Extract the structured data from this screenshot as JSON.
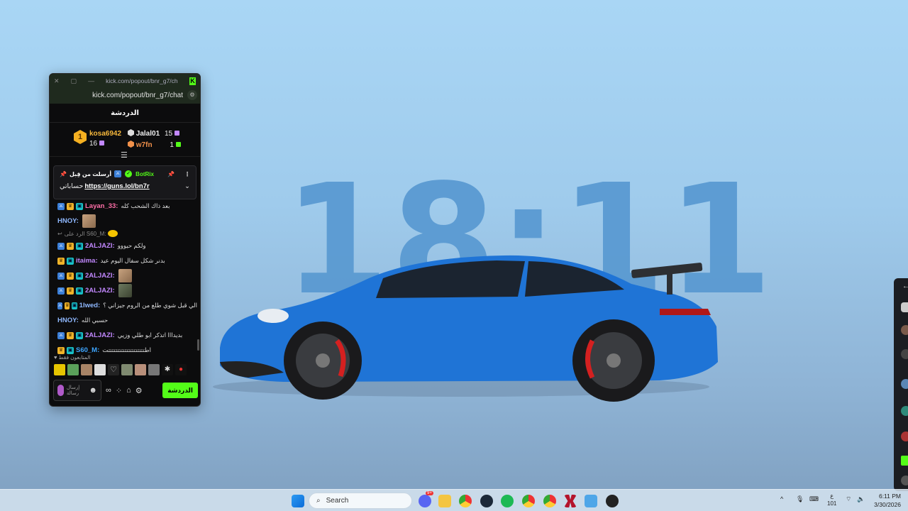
{
  "wallpaper": {
    "clock": "18:11"
  },
  "popout": {
    "window_title": "kick.com/popout/bnr_g7/ch...",
    "url": "kick.com/popout/bnr_g7/chat",
    "chat_heading": "الدردشة",
    "leaderboard": [
      {
        "rank": "1",
        "name": "kosa6942",
        "count": "16"
      },
      {
        "name": "Jalal01",
        "count": "15"
      },
      {
        "name": "w7fn",
        "count": "1"
      }
    ],
    "pinned": {
      "user": "BotRix",
      "sent_by_label": "أرسلت من قِبل",
      "message_prefix": "حساباتي",
      "link": "https://guns.lol/bn7r"
    },
    "messages": [
      {
        "user": "Layan_33:",
        "text": "بعد ذاك الشحب كله"
      },
      {
        "user": "HNOY:",
        "text": ""
      },
      {
        "reply": "الرد على S60_M:"
      },
      {
        "user": "2ALJAZI:",
        "text": "ولكم حيووو"
      },
      {
        "user": "itaima:",
        "text": "بدنر شكل سفال اليوم عيد"
      },
      {
        "user": "2ALJAZI:",
        "text": ""
      },
      {
        "user": "2ALJAZI:",
        "text": ""
      },
      {
        "user": "1lwed:",
        "text": "الي قبل شوي طلع من الروم جيزاني ؟"
      },
      {
        "user": "HNOY:",
        "text": "حسبي الله"
      },
      {
        "user": "2ALJAZI:",
        "text": "بديدااا اتذكر ابو طلي وزيي"
      },
      {
        "user": "S60_M:",
        "text": "اطتتتتتتتتتتتتتتتتتتتتت"
      }
    ],
    "emote_header": "المتابعون فقط",
    "input_placeholder": "إرسال رسالة",
    "send_label": "الدردشة"
  },
  "taskbar": {
    "search_placeholder": "Search",
    "time": "6:11 PM",
    "date": "3/30/2026",
    "lang": "ع",
    "lang_sub": "101",
    "discord_badge": "9+"
  },
  "colors": {
    "kick_green": "#53fc18",
    "wallpaper_blue": "#a9d6f5"
  }
}
